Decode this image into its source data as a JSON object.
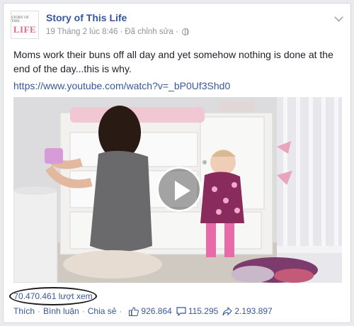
{
  "post": {
    "page_name": "Story of This Life",
    "avatar_logo_text": [
      "STORY OF THIS",
      "LIFE"
    ],
    "timestamp": "19 Tháng 2 lúc 8:46",
    "edited": "Đã chỉnh sửa",
    "separator": "·",
    "text": "Moms work their buns off all day and yet somehow nothing is done at the end of the day...this is why.",
    "link": "https://www.youtube.com/watch?v=_bP0Uf3Shd0"
  },
  "video": {
    "views": "70.470.461 lượt xem"
  },
  "actions": {
    "like": "Thích",
    "comment": "Bình luận",
    "share": "Chia sẻ",
    "dot": "·"
  },
  "stats": {
    "likes": "926.864",
    "comments": "115.295",
    "shares": "2.193.897"
  },
  "colors": {
    "link": "#365899",
    "meta": "#90949c",
    "background": "#e9ebee"
  },
  "icons": [
    "globe-icon",
    "chevron-down-icon",
    "play-icon",
    "thumbs-up-icon",
    "comment-icon",
    "share-icon"
  ]
}
